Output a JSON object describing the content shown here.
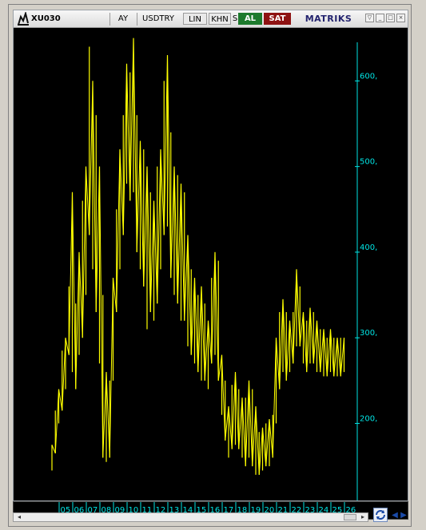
{
  "toolbar": {
    "symbol": "XU030",
    "period": "AY",
    "currency": "USDTRY",
    "scale": "LIN",
    "chart_style": "KHN",
    "hidden_letter": "S",
    "buy_label": "AL",
    "sell_label": "SAT",
    "brand": "MATRIKS"
  },
  "colors": {
    "background": "#000000",
    "price_line": "#ffff00",
    "axis_text": "#00e5e5",
    "buy": "#1d7a2d",
    "sell": "#8e1212"
  },
  "chart_data": {
    "type": "line",
    "title": "",
    "xlabel": "",
    "ylabel": "",
    "y_axis_side": "right",
    "ylim": [
      110,
      660
    ],
    "y_ticks": [
      {
        "value": 200,
        "label": "200,"
      },
      {
        "value": 300,
        "label": "300,"
      },
      {
        "value": 400,
        "label": "400,"
      },
      {
        "value": 500,
        "label": "500,"
      },
      {
        "value": 600,
        "label": "600,"
      }
    ],
    "x_ticks": [
      "05",
      "06",
      "07",
      "08",
      "09",
      "10",
      "11",
      "12",
      "13",
      "14",
      "15",
      "16",
      "17",
      "18",
      "19",
      "20",
      "21",
      "22",
      "23",
      "24",
      "25",
      "26"
    ],
    "grid": false,
    "legend": "none",
    "series": [
      {
        "x": [
          2004.0,
          2004.25,
          2004.5,
          2004.75,
          2005.0,
          2005.25,
          2005.5,
          2005.75,
          2006.0,
          2006.25,
          2006.5,
          2006.75,
          2007.0,
          2007.25,
          2007.5,
          2007.75,
          2008.0,
          2008.25,
          2008.5,
          2008.75,
          2009.0,
          2009.25,
          2009.5,
          2009.75,
          2010.0,
          2010.25,
          2010.5,
          2010.75,
          2011.0,
          2011.25,
          2011.5,
          2011.75,
          2012.0,
          2012.25,
          2012.5,
          2012.75,
          2013.0,
          2013.25,
          2013.5,
          2013.75,
          2014.0,
          2014.25,
          2014.5,
          2014.75,
          2015.0,
          2015.25,
          2015.5,
          2015.75,
          2016.0,
          2016.25,
          2016.5,
          2016.75,
          2017.0,
          2017.25,
          2017.5,
          2017.75,
          2018.0,
          2018.25,
          2018.5,
          2018.75,
          2019.0,
          2019.25,
          2019.5,
          2019.75,
          2020.0,
          2020.25,
          2020.5,
          2020.75,
          2021.0,
          2021.25,
          2021.5,
          2021.75,
          2022.0,
          2022.25,
          2022.5,
          2022.75,
          2023.0,
          2023.25,
          2023.5,
          2023.75,
          2024.0,
          2024.25,
          2024.5,
          2024.75,
          2025.0,
          2025.25,
          2025.5
        ],
        "high": [
          175,
          215,
          240,
          285,
          300,
          360,
          470,
          340,
          400,
          460,
          500,
          640,
          600,
          560,
          500,
          350,
          260,
          250,
          370,
          450,
          520,
          560,
          620,
          610,
          650,
          560,
          530,
          520,
          500,
          470,
          460,
          500,
          520,
          600,
          630,
          540,
          500,
          490,
          480,
          470,
          420,
          380,
          370,
          350,
          360,
          340,
          320,
          370,
          400,
          390,
          280,
          250,
          220,
          245,
          260,
          240,
          230,
          230,
          250,
          240,
          220,
          190,
          195,
          200,
          205,
          210,
          300,
          330,
          345,
          330,
          320,
          330,
          380,
          360,
          330,
          320,
          335,
          330,
          320,
          310,
          310,
          300,
          310,
          300,
          300,
          300,
          300
        ],
        "low": [
          145,
          165,
          200,
          215,
          240,
          280,
          260,
          240,
          280,
          300,
          350,
          420,
          380,
          330,
          270,
          160,
          155,
          160,
          250,
          330,
          380,
          420,
          480,
          460,
          470,
          400,
          380,
          360,
          310,
          330,
          320,
          340,
          380,
          420,
          430,
          370,
          350,
          340,
          320,
          320,
          290,
          280,
          270,
          260,
          250,
          250,
          240,
          270,
          280,
          250,
          210,
          180,
          160,
          170,
          175,
          170,
          160,
          150,
          160,
          150,
          140,
          140,
          145,
          150,
          150,
          160,
          200,
          240,
          260,
          250,
          260,
          270,
          290,
          290,
          270,
          260,
          270,
          270,
          260,
          260,
          255,
          255,
          260,
          255,
          255,
          255,
          260
        ]
      }
    ]
  }
}
